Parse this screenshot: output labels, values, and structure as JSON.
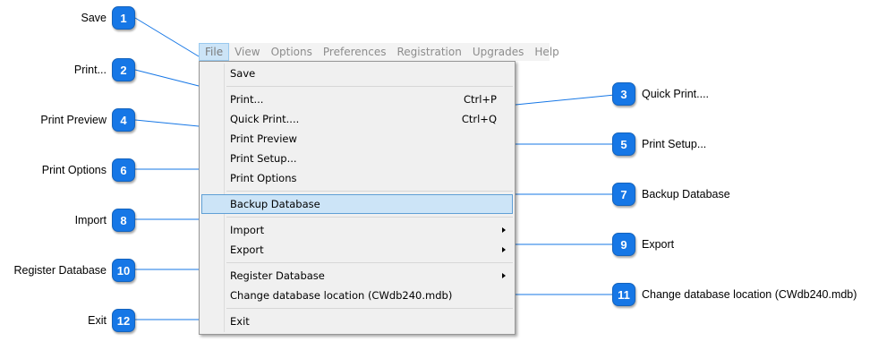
{
  "menubar": {
    "items": [
      {
        "label": "File",
        "active": true
      },
      {
        "label": "View"
      },
      {
        "label": "Options"
      },
      {
        "label": "Preferences"
      },
      {
        "label": "Registration"
      },
      {
        "label": "Upgrades"
      },
      {
        "label": "Help"
      }
    ]
  },
  "file_menu": {
    "save": "Save",
    "print": "Print...",
    "print_shortcut": "Ctrl+P",
    "quick_print": "Quick Print....",
    "quick_print_shortcut": "Ctrl+Q",
    "print_preview": "Print Preview",
    "print_setup": "Print Setup...",
    "print_options": "Print Options",
    "backup_database": "Backup Database",
    "import": "Import",
    "export": "Export",
    "register_database": "Register Database",
    "change_database_location": "Change database location (CWdb240.mdb)",
    "exit": "Exit",
    "highlighted_item": "Backup Database"
  },
  "callouts": {
    "colors": {
      "badge": "#1677e6",
      "line": "#1677e6"
    },
    "items": [
      {
        "number": "1",
        "label": "Save"
      },
      {
        "number": "2",
        "label": "Print..."
      },
      {
        "number": "3",
        "label": "Quick Print...."
      },
      {
        "number": "4",
        "label": "Print Preview"
      },
      {
        "number": "5",
        "label": "Print Setup..."
      },
      {
        "number": "6",
        "label": "Print Options"
      },
      {
        "number": "7",
        "label": "Backup Database"
      },
      {
        "number": "8",
        "label": "Import"
      },
      {
        "number": "9",
        "label": "Export"
      },
      {
        "number": "10",
        "label": "Register Database"
      },
      {
        "number": "11",
        "label": "Change database location (CWdb240.mdb)"
      },
      {
        "number": "12",
        "label": "Exit"
      }
    ]
  }
}
